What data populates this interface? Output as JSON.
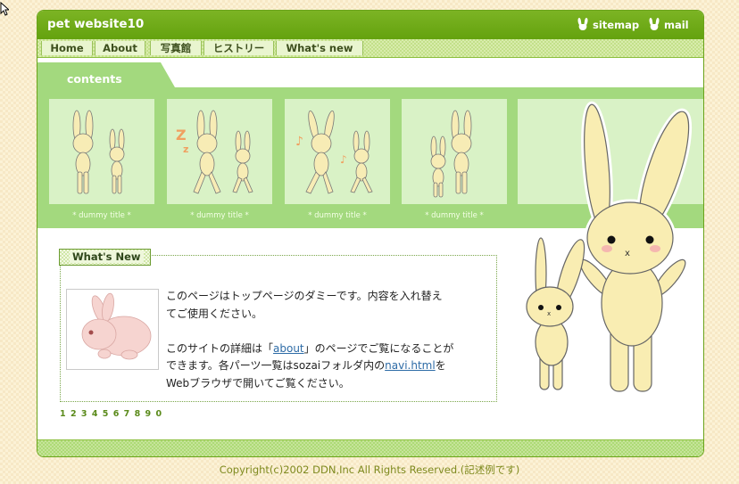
{
  "header": {
    "title": "pet website10",
    "links": [
      {
        "label": "sitemap",
        "icon": "rabbit-icon"
      },
      {
        "label": "mail",
        "icon": "rabbit-icon"
      }
    ]
  },
  "nav": {
    "items": [
      {
        "label": "Home"
      },
      {
        "label": "About"
      },
      {
        "label": "写真館"
      },
      {
        "label": "ヒストリー"
      },
      {
        "label": "What's new"
      }
    ]
  },
  "contents": {
    "label": "contents",
    "thumbnails": [
      {
        "caption": "* dummy title *"
      },
      {
        "caption": "* dummy title *"
      },
      {
        "caption": "* dummy title *"
      },
      {
        "caption": "* dummy title *"
      }
    ]
  },
  "whats_new": {
    "heading": "What's New",
    "text_1a": "このページはトップページのダミーです。内容を入れ替え",
    "text_1b": "てご使用ください。",
    "text_2a_pre": "このサイトの詳細は「",
    "text_2a_link": "about",
    "text_2a_post": "」のページでご覧になることが",
    "text_2b_pre": "できます。各パーツ一覧はsozaiフォルダ内の",
    "text_2b_link": "navi.html",
    "text_2b_post": "を",
    "text_2c": "Webブラウザで開いてご覧ください。"
  },
  "pager": [
    "1",
    "2",
    "3",
    "4",
    "5",
    "6",
    "7",
    "8",
    "9",
    "0"
  ],
  "footer": {
    "copyright": "Copyright(c)2002 DDN,Inc All Rights Reserved.(記述例です)"
  },
  "colors": {
    "header_green": "#6aa31a",
    "band_green": "#a3d97e",
    "thumb_bg": "#d9f2c6",
    "link_blue": "#2d6ba6",
    "copyright_text": "#7e8a1f"
  }
}
